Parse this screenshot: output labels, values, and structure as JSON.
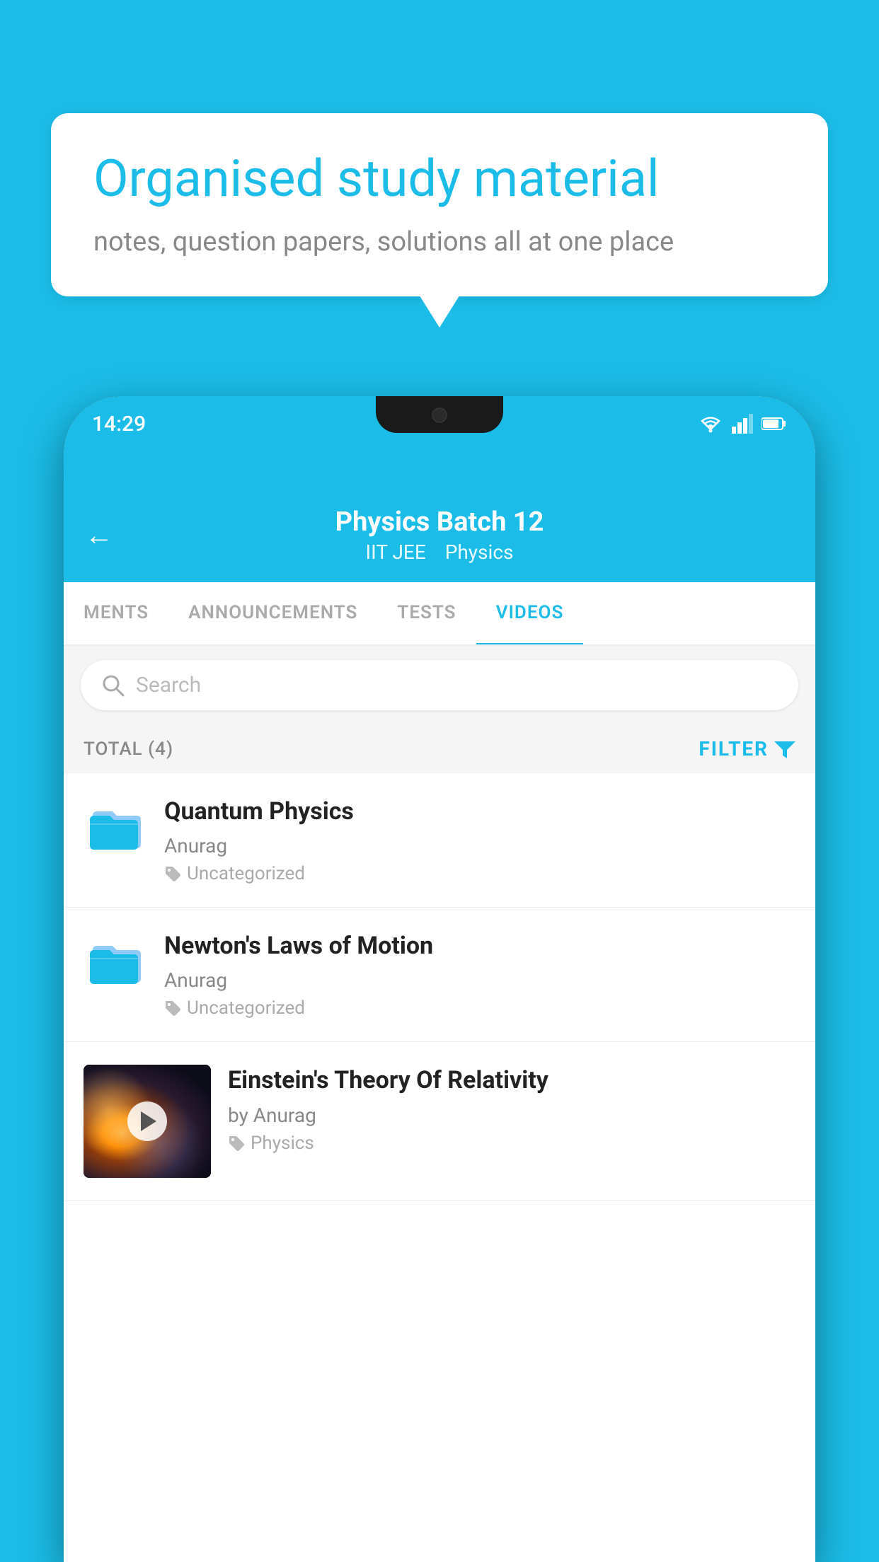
{
  "background_color": "#1BBDE8",
  "speech_bubble": {
    "title": "Organised study material",
    "subtitle": "notes, question papers, solutions all at one place"
  },
  "phone": {
    "status_bar": {
      "time": "14:29",
      "icons": [
        "wifi",
        "signal",
        "battery"
      ]
    },
    "header": {
      "title": "Physics Batch 12",
      "subtitle_parts": [
        "IIT JEE",
        "Physics"
      ],
      "back_label": "←"
    },
    "tabs": [
      {
        "label": "MENTS",
        "active": false
      },
      {
        "label": "ANNOUNCEMENTS",
        "active": false
      },
      {
        "label": "TESTS",
        "active": false
      },
      {
        "label": "VIDEOS",
        "active": true
      }
    ],
    "search": {
      "placeholder": "Search"
    },
    "filter_bar": {
      "total_label": "TOTAL (4)",
      "filter_label": "FILTER"
    },
    "videos": [
      {
        "id": 1,
        "title": "Quantum Physics",
        "author": "Anurag",
        "tag": "Uncategorized",
        "has_thumbnail": false
      },
      {
        "id": 2,
        "title": "Newton's Laws of Motion",
        "author": "Anurag",
        "tag": "Uncategorized",
        "has_thumbnail": false
      },
      {
        "id": 3,
        "title": "Einstein's Theory Of Relativity",
        "author": "by Anurag",
        "tag": "Physics",
        "has_thumbnail": true
      }
    ]
  }
}
